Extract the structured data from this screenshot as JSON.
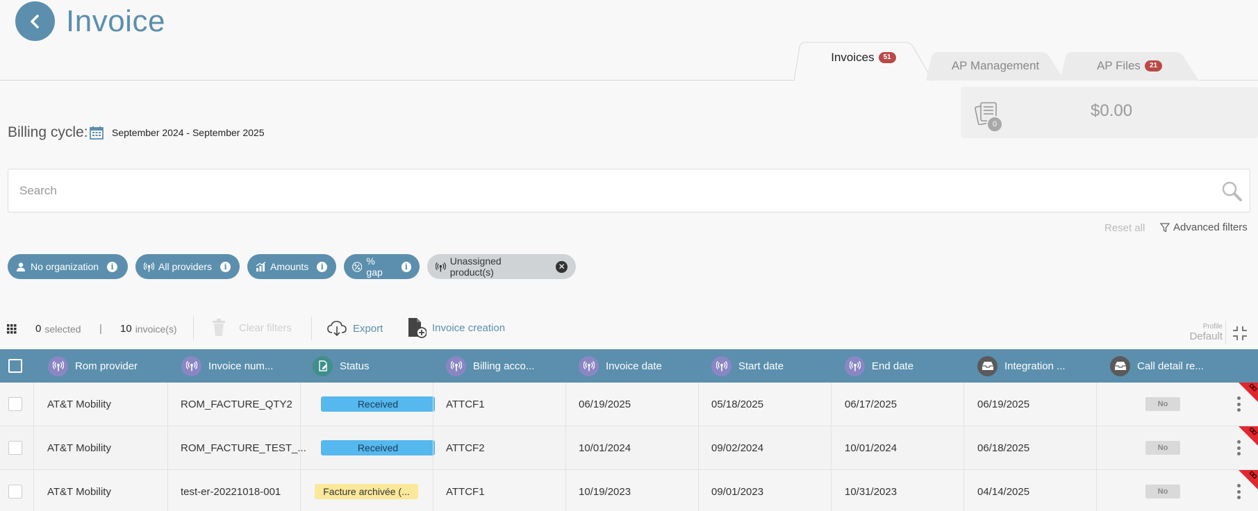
{
  "page": {
    "title": "Invoice"
  },
  "tabs": [
    {
      "label": "Invoices",
      "badge": "51",
      "active": true
    },
    {
      "label": "AP Management",
      "badge": "",
      "active": false
    },
    {
      "label": "AP Files",
      "badge": "21",
      "active": false
    }
  ],
  "summary": {
    "count": "0",
    "amount": "$0.00"
  },
  "billing": {
    "label": "Billing cycle:",
    "range": "September 2024 - September 2025"
  },
  "search": {
    "placeholder": "Search",
    "value": ""
  },
  "filters": {
    "reset_label": "Reset all",
    "advanced_label": "Advanced filters"
  },
  "chips": [
    {
      "label": "No organization",
      "icon": "org-icon"
    },
    {
      "label": "All providers",
      "icon": "antenna-icon"
    },
    {
      "label": "Amounts",
      "icon": "chart-icon"
    },
    {
      "label": "% gap",
      "icon": "percent-icon"
    },
    {
      "label": "Unassigned product(s)",
      "icon": "antenna-icon"
    }
  ],
  "toolbar": {
    "selected_count": "0",
    "selected_label": "selected",
    "divider": "|",
    "invoice_count": "10",
    "invoice_label": "invoice(s)",
    "clear_label": "Clear filters",
    "export_label": "Export",
    "create_label": "Invoice creation",
    "profile_label": "Profile",
    "profile_value": "Default"
  },
  "columns": [
    {
      "label": "Rom provider",
      "icon": "antenna-icon"
    },
    {
      "label": "Invoice num...",
      "icon": "antenna-icon"
    },
    {
      "label": "Status",
      "icon": "document-edit-icon"
    },
    {
      "label": "Billing acco...",
      "icon": "antenna-icon"
    },
    {
      "label": "Invoice date",
      "icon": "antenna-icon"
    },
    {
      "label": "Start date",
      "icon": "antenna-icon"
    },
    {
      "label": "End date",
      "icon": "antenna-icon"
    },
    {
      "label": "Integration ...",
      "icon": "inbox-icon"
    },
    {
      "label": "Call detail re...",
      "icon": "inbox-icon"
    }
  ],
  "rows": [
    {
      "provider": "AT&T Mobility",
      "number": "ROM_FACTURE_QTY2",
      "status": "Received",
      "status_color": "#55b8ee",
      "account": "ATTCF1",
      "invoice_date": "06/19/2025",
      "start": "05/18/2025",
      "end": "06/17/2025",
      "integration": "06/19/2025",
      "cdr": "No"
    },
    {
      "provider": "AT&T Mobility",
      "number": "ROM_FACTURE_TEST_...",
      "status": "Received",
      "status_color": "#55b8ee",
      "account": "ATTCF2",
      "invoice_date": "10/01/2024",
      "start": "09/02/2024",
      "end": "10/01/2024",
      "integration": "06/18/2025",
      "cdr": "No"
    },
    {
      "provider": "AT&T Mobility",
      "number": "test-er-20221018-001",
      "status": "Facture archivée (...",
      "status_color": "#fbe89a",
      "account": "ATTCF1",
      "invoice_date": "10/19/2023",
      "start": "09/01/2023",
      "end": "10/31/2023",
      "integration": "04/14/2025",
      "cdr": "No"
    }
  ],
  "colors": {
    "accent": "#5b8fad",
    "badge": "#b94a48",
    "received": "#55b8ee",
    "archived": "#fbe89a",
    "corner_flag": "#e0282e"
  }
}
